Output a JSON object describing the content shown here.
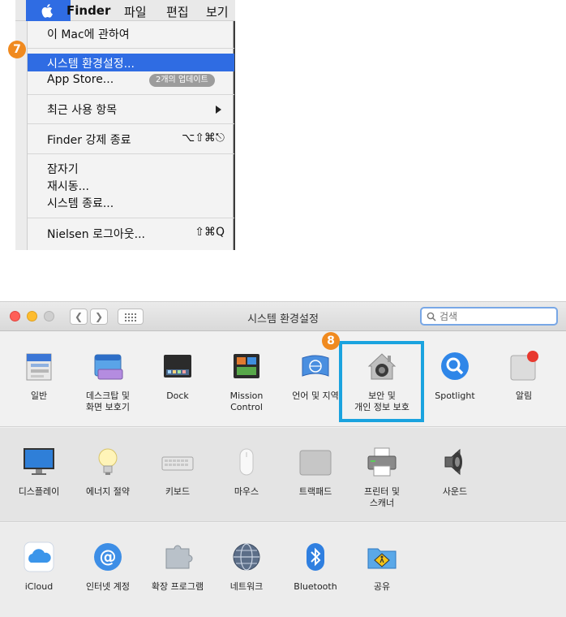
{
  "menubar": {
    "app_name": "Finder",
    "menus": [
      "파일",
      "편집",
      "보기"
    ]
  },
  "apple_menu": {
    "items": [
      {
        "label": "이 Mac에 관하여"
      },
      {
        "label": "시스템 환경설정..."
      },
      {
        "label": "App Store...",
        "badge": "2개의 업데이트"
      },
      {
        "label": "최근 사용 항목"
      },
      {
        "label": "Finder 강제 종료",
        "shortcut": "⌥⇧⌘⎋"
      },
      {
        "label": "잠자기"
      },
      {
        "label": "재시동..."
      },
      {
        "label": "시스템 종료..."
      },
      {
        "label": "Nielsen 로그아웃...",
        "shortcut": "⇧⌘Q"
      }
    ],
    "highlighted_index": 1
  },
  "steps": {
    "step1": "7",
    "step2": "8"
  },
  "prefs_window": {
    "title": "시스템 환경설정",
    "search_placeholder": "검색",
    "rows": [
      [
        {
          "name": "일반",
          "icon": "general-icon"
        },
        {
          "name": "데스크탑 및\n화면 보호기",
          "icon": "desktop-screensaver-icon"
        },
        {
          "name": "Dock",
          "icon": "dock-icon"
        },
        {
          "name": "Mission\nControl",
          "icon": "mission-control-icon"
        },
        {
          "name": "언어 및 지역",
          "icon": "language-region-icon"
        },
        {
          "name": "보안 및\n개인 정보 보호",
          "icon": "security-privacy-icon"
        },
        {
          "name": "Spotlight",
          "icon": "spotlight-icon"
        },
        {
          "name": "알림",
          "icon": "notifications-icon"
        }
      ],
      [
        {
          "name": "디스플레이",
          "icon": "display-icon"
        },
        {
          "name": "에너지 절약",
          "icon": "energy-saver-icon"
        },
        {
          "name": "키보드",
          "icon": "keyboard-icon"
        },
        {
          "name": "마우스",
          "icon": "mouse-icon"
        },
        {
          "name": "트랙패드",
          "icon": "trackpad-icon"
        },
        {
          "name": "프린터 및\n스캐너",
          "icon": "printer-scanner-icon"
        },
        {
          "name": "사운드",
          "icon": "sound-icon"
        }
      ],
      [
        {
          "name": "iCloud",
          "icon": "icloud-icon"
        },
        {
          "name": "인터넷 계정",
          "icon": "internet-accounts-icon"
        },
        {
          "name": "확장 프로그램",
          "icon": "extensions-icon"
        },
        {
          "name": "네트워크",
          "icon": "network-icon"
        },
        {
          "name": "Bluetooth",
          "icon": "bluetooth-icon"
        },
        {
          "name": "공유",
          "icon": "sharing-icon"
        }
      ]
    ]
  },
  "colors": {
    "menu_highlight": "#2f6ce3",
    "step_badge": "#f08a1f",
    "callout_box": "#1aa3df"
  }
}
